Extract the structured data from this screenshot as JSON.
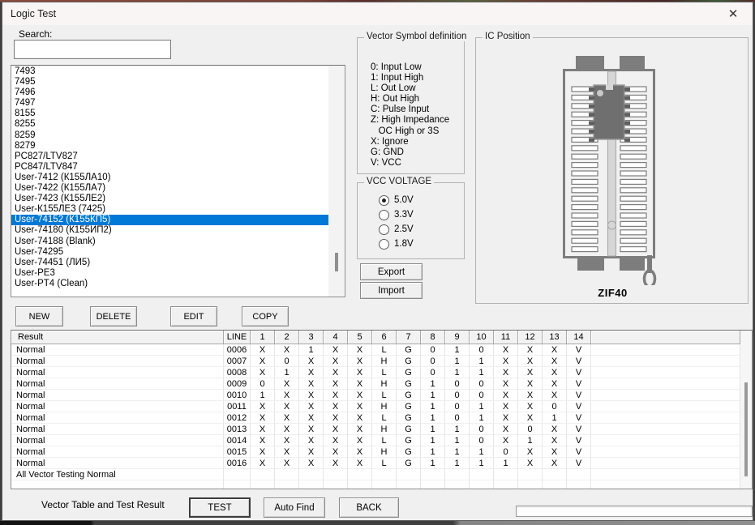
{
  "window": {
    "title": "Logic Test",
    "close_icon": "✕"
  },
  "search": {
    "label": "Search:",
    "value": ""
  },
  "chip_list": {
    "items": [
      "7493",
      "7495",
      "7496",
      "7497",
      "8155",
      "8255",
      "8259",
      "8279",
      "PC827/LTV827",
      "PC847/LTV847",
      "User-7412 (К155ЛА10)",
      "User-7422 (К155ЛА7)",
      "User-7423 (К155ЛЕ2)",
      "User-К155ЛЕ3 (7425)",
      "User-74152 (К155КП5)",
      "User-74180 (К155ИП2)",
      "User-74188 (Blank)",
      "User-74295",
      "User-74451 (ЛИ5)",
      "User-PE3",
      "User-PT4 (Clean)"
    ],
    "selected_index": 14
  },
  "list_buttons": {
    "new": "NEW",
    "delete": "DELETE",
    "edit": "EDIT",
    "copy": "COPY"
  },
  "vector_symbols": {
    "title": "Vector Symbol definition",
    "lines": [
      "0: Input Low",
      "1: Input High",
      "L: Out Low",
      "H: Out High",
      "C: Pulse Input",
      "Z: High Impedance",
      "   OC High or 3S",
      "X: Ignore",
      "G: GND",
      "V: VCC"
    ]
  },
  "vcc_voltage": {
    "title": "VCC VOLTAGE",
    "options": [
      {
        "label": "5.0V",
        "selected": true
      },
      {
        "label": "3.3V",
        "selected": false
      },
      {
        "label": "2.5V",
        "selected": false
      },
      {
        "label": "1.8V",
        "selected": false
      }
    ]
  },
  "io_buttons": {
    "export": "Export",
    "import": "Import"
  },
  "ic_position": {
    "title": "IC Position",
    "socket_label": "ZIF40",
    "pins_per_side": 20,
    "chip_pins_per_side": 7
  },
  "vector_table": {
    "headers": [
      "Result",
      "LINE",
      "1",
      "2",
      "3",
      "4",
      "5",
      "6",
      "7",
      "8",
      "9",
      "10",
      "11",
      "12",
      "13",
      "14"
    ],
    "rows": [
      {
        "result": "Normal",
        "line": "0006",
        "values": [
          "X",
          "X",
          "1",
          "X",
          "X",
          "L",
          "G",
          "0",
          "1",
          "0",
          "X",
          "X",
          "X",
          "V"
        ]
      },
      {
        "result": "Normal",
        "line": "0007",
        "values": [
          "X",
          "0",
          "X",
          "X",
          "X",
          "H",
          "G",
          "0",
          "1",
          "1",
          "X",
          "X",
          "X",
          "V"
        ]
      },
      {
        "result": "Normal",
        "line": "0008",
        "values": [
          "X",
          "1",
          "X",
          "X",
          "X",
          "L",
          "G",
          "0",
          "1",
          "1",
          "X",
          "X",
          "X",
          "V"
        ]
      },
      {
        "result": "Normal",
        "line": "0009",
        "values": [
          "0",
          "X",
          "X",
          "X",
          "X",
          "H",
          "G",
          "1",
          "0",
          "0",
          "X",
          "X",
          "X",
          "V"
        ]
      },
      {
        "result": "Normal",
        "line": "0010",
        "values": [
          "1",
          "X",
          "X",
          "X",
          "X",
          "L",
          "G",
          "1",
          "0",
          "0",
          "X",
          "X",
          "X",
          "V"
        ]
      },
      {
        "result": "Normal",
        "line": "0011",
        "values": [
          "X",
          "X",
          "X",
          "X",
          "X",
          "H",
          "G",
          "1",
          "0",
          "1",
          "X",
          "X",
          "0",
          "V"
        ]
      },
      {
        "result": "Normal",
        "line": "0012",
        "values": [
          "X",
          "X",
          "X",
          "X",
          "X",
          "L",
          "G",
          "1",
          "0",
          "1",
          "X",
          "X",
          "1",
          "V"
        ]
      },
      {
        "result": "Normal",
        "line": "0013",
        "values": [
          "X",
          "X",
          "X",
          "X",
          "X",
          "H",
          "G",
          "1",
          "1",
          "0",
          "X",
          "0",
          "X",
          "V"
        ]
      },
      {
        "result": "Normal",
        "line": "0014",
        "values": [
          "X",
          "X",
          "X",
          "X",
          "X",
          "L",
          "G",
          "1",
          "1",
          "0",
          "X",
          "1",
          "X",
          "V"
        ]
      },
      {
        "result": "Normal",
        "line": "0015",
        "values": [
          "X",
          "X",
          "X",
          "X",
          "X",
          "H",
          "G",
          "1",
          "1",
          "1",
          "0",
          "X",
          "X",
          "V"
        ]
      },
      {
        "result": "Normal",
        "line": "0016",
        "values": [
          "X",
          "X",
          "X",
          "X",
          "X",
          "L",
          "G",
          "1",
          "1",
          "1",
          "1",
          "X",
          "X",
          "V"
        ]
      }
    ],
    "summary_row": "All Vector Testing Normal"
  },
  "footer": {
    "status": "Vector Table and Test Result",
    "test": "TEST",
    "auto_find": "Auto Find",
    "back": "BACK"
  },
  "colors": {
    "selection": "#0078d7",
    "socket_gray": "#7d7d7d",
    "chip_gray": "#6f6f6f",
    "rail_gray": "#d6d6d6"
  }
}
